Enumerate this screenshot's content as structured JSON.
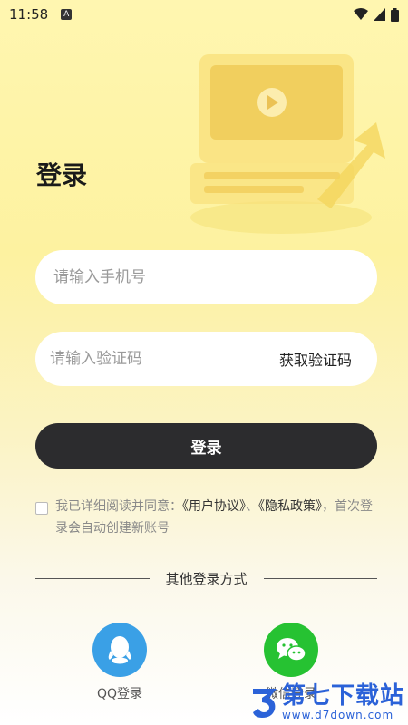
{
  "status_bar": {
    "time": "11:58",
    "notif_letter": "A"
  },
  "page": {
    "title": "登录"
  },
  "form": {
    "phone_placeholder": "请输入手机号",
    "phone_value": "",
    "code_placeholder": "请输入验证码",
    "code_value": "",
    "get_code_label": "获取验证码",
    "login_label": "登录"
  },
  "agreement": {
    "prefix": "我已详细阅读并同意：",
    "user_agreement": "《用户协议》",
    "separator": "、",
    "privacy_policy": "《隐私政策》",
    "suffix": "，首次登录会自动创建新账号"
  },
  "other_login": {
    "label": "其他登录方式",
    "qq_label": "QQ登录",
    "wechat_label": "微信登录"
  },
  "watermark": {
    "title": "第七下载站",
    "url": "www.d7down.com"
  },
  "colors": {
    "accent_dark": "#2c2c2e",
    "qq_blue": "#3aa0e6",
    "wechat_green": "#26c232",
    "watermark_blue": "#2b62d8"
  }
}
